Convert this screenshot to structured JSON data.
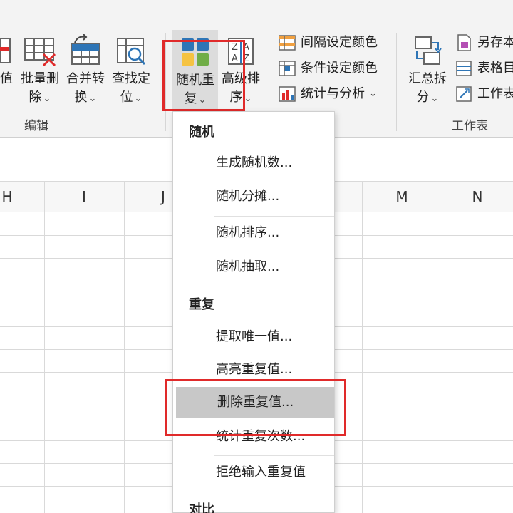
{
  "ribbon": {
    "partial_left_label_1": "值",
    "partial_left_label_2": "⌄",
    "buttons": {
      "batch_delete": {
        "line1": "批量删",
        "line2": "除"
      },
      "merge_convert": {
        "line1": "合并转",
        "line2": "换"
      },
      "find_locate": {
        "line1": "查找定",
        "line2": "位"
      },
      "random_repeat": {
        "line1": "随机重",
        "line2": "复"
      },
      "advanced_sort": {
        "line1": "高级排",
        "line2": "序"
      },
      "summary_split": {
        "line1": "汇总拆",
        "line2": "分"
      }
    },
    "small_buttons": {
      "interval_color": "间隔设定颜色",
      "conditional_color": "条件设定颜色",
      "stats_analysis": "统计与分析",
      "save_as": "另存本",
      "table_dir": "表格目",
      "worksheet": "工作表"
    },
    "groups": {
      "edit": "编辑",
      "worksheet": "工作表"
    },
    "colors": {
      "accent_red": "#e02a2a",
      "icon_blue": "#2e75b6",
      "icon_orange": "#f5a623",
      "icon_green": "#70ad47"
    }
  },
  "sheet": {
    "columns": [
      "H",
      "I",
      "J",
      "M",
      "N"
    ]
  },
  "menu": {
    "section_random": "随机",
    "items_random": [
      "生成随机数...",
      "随机分摊...",
      "随机排序...",
      "随机抽取..."
    ],
    "section_repeat": "重复",
    "items_repeat": [
      "提取唯一值...",
      "高亮重复值...",
      "删除重复值...",
      "统计重复次数...",
      "拒绝输入重复值"
    ],
    "section_compare": "对比",
    "highlighted_item": "删除重复值..."
  }
}
